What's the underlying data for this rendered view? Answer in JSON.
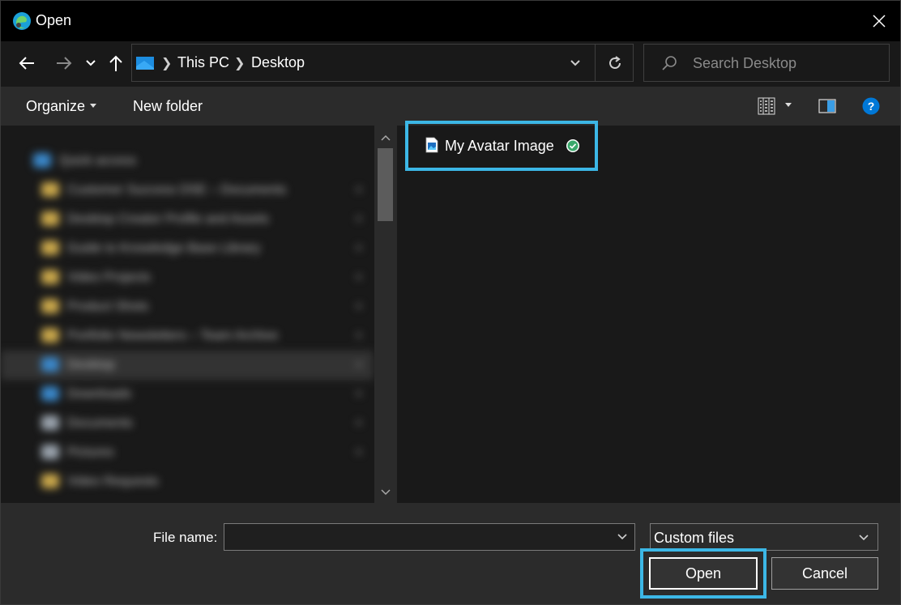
{
  "window": {
    "title": "Open",
    "icon": "edge-browser-icon"
  },
  "nav": {
    "back_icon": "arrow-left-icon",
    "forward_icon": "arrow-right-icon",
    "recent_icon": "chevron-down-icon",
    "up_icon": "arrow-up-icon"
  },
  "address": {
    "crumbs": [
      "This PC",
      "Desktop"
    ],
    "icon": "desktop-icon"
  },
  "search": {
    "placeholder": "Search Desktop"
  },
  "toolbar": {
    "organize_label": "Organize",
    "new_folder_label": "New folder"
  },
  "sidebar": {
    "items": [
      {
        "label": "Quick access",
        "icon": "star-icon"
      },
      {
        "label": "Customer Success DSE – Documents",
        "icon": "folder-icon"
      },
      {
        "label": "Desktop Creator Profile and Assets",
        "icon": "folder-icon"
      },
      {
        "label": "Guide to Knowledge Base Library",
        "icon": "folder-icon"
      },
      {
        "label": "Video Projects",
        "icon": "folder-icon"
      },
      {
        "label": "Product Shots",
        "icon": "folder-icon"
      },
      {
        "label": "Portfolio Newsletters – Team Archive",
        "icon": "folder-icon"
      },
      {
        "label": "Desktop",
        "icon": "desktop-icon"
      },
      {
        "label": "Downloads",
        "icon": "download-icon"
      },
      {
        "label": "Documents",
        "icon": "document-icon"
      },
      {
        "label": "Pictures",
        "icon": "picture-icon"
      },
      {
        "label": "Video Requests",
        "icon": "folder-icon"
      }
    ]
  },
  "files": [
    {
      "name": "My Avatar Image",
      "icon": "image-file-icon",
      "status": "synced"
    }
  ],
  "footer": {
    "file_name_label": "File name:",
    "file_name_value": "",
    "filter_value": "Custom files",
    "open_label": "Open",
    "cancel_label": "Cancel"
  },
  "colors": {
    "highlight": "#3cb7e6",
    "accent": "#0078d7"
  }
}
